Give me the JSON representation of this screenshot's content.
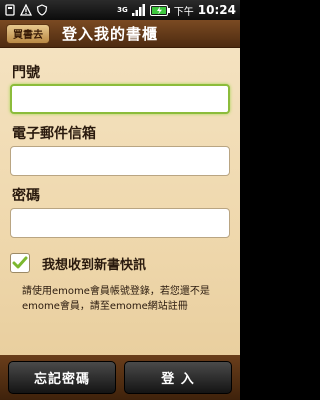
{
  "status_bar": {
    "network_type": "3G",
    "clock_ampm": "下午",
    "clock_time": "10:24",
    "icons": [
      "usb-debug-icon",
      "warning-icon",
      "shield-icon",
      "signal-icon",
      "battery-icon"
    ]
  },
  "header": {
    "back_label": "買書去",
    "title": "登入我的書櫃"
  },
  "form": {
    "account_label": "門號",
    "account_value": "",
    "email_label": "電子郵件信箱",
    "email_value": "",
    "password_label": "密碼",
    "password_value": ""
  },
  "newsletter": {
    "label": "我想收到新書快訊",
    "checked": true
  },
  "hint": {
    "text": "請使用emome會員帳號登錄，若您還不是emome會員，請至emome網站註冊"
  },
  "bottom": {
    "forgot_label": "忘記密碼",
    "login_label": "登 入"
  },
  "colors": {
    "header_brown": "#5e3616",
    "content_bg": "#f1dcb5",
    "focus_green": "#8cbc3b"
  }
}
